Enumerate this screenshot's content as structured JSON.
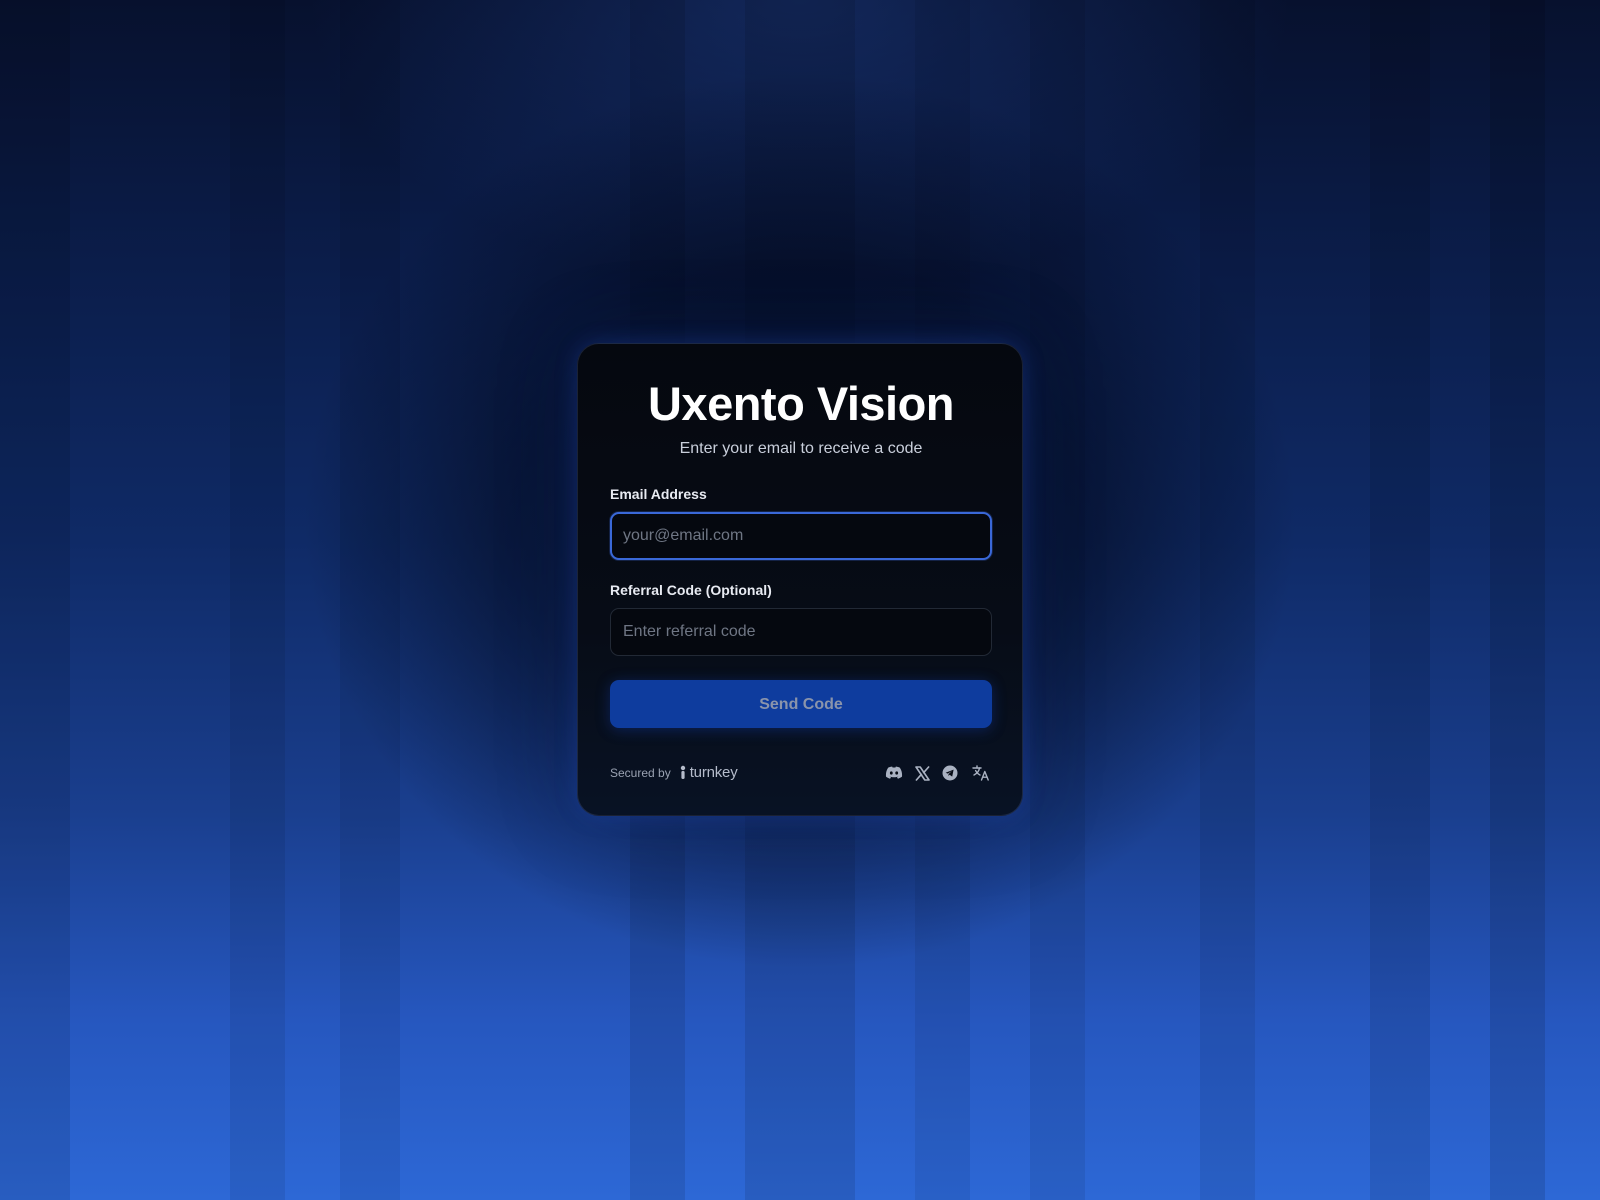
{
  "app": {
    "title": "Uxento Vision",
    "subtitle": "Enter your email to receive a code"
  },
  "form": {
    "email": {
      "label": "Email Address",
      "placeholder": "your@email.com",
      "value": ""
    },
    "referral": {
      "label": "Referral Code (Optional)",
      "placeholder": "Enter referral code",
      "value": ""
    },
    "submit_label": "Send Code"
  },
  "footer": {
    "secured_by": "Secured by",
    "provider_name": "turnkey",
    "links": [
      "discord-icon",
      "x-icon",
      "telegram-icon",
      "translate-icon"
    ]
  },
  "colors": {
    "accent": "#0e3c9e",
    "focus_border": "#3a68d8",
    "card_bg": "#05080f",
    "background_bottom": "#2d68d6"
  }
}
